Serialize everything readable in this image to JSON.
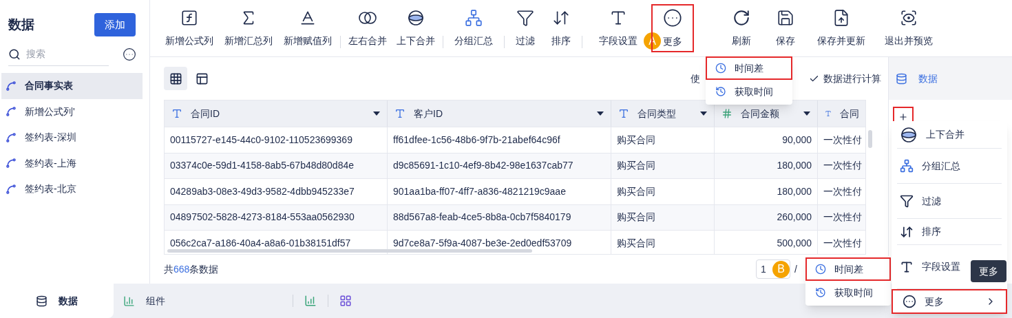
{
  "sidebar": {
    "title": "数据",
    "add_button": "添加",
    "search": {
      "placeholder": "搜索"
    },
    "items": [
      {
        "label": "合同事实表",
        "selected": true
      },
      {
        "label": "新增公式列'",
        "selected": false
      },
      {
        "label": "签约表-深圳",
        "selected": false
      },
      {
        "label": "签约表-上海",
        "selected": false
      },
      {
        "label": "签约表-北京",
        "selected": false
      }
    ]
  },
  "toolbar": {
    "groups": [
      [
        {
          "label": "新增公式列"
        },
        {
          "label": "新增汇总列"
        },
        {
          "label": "新增赋值列"
        }
      ],
      [
        {
          "label": "左右合并"
        },
        {
          "label": "上下合并"
        }
      ],
      [
        {
          "label": "分组汇总"
        }
      ],
      [
        {
          "label": "过滤"
        },
        {
          "label": "排序"
        }
      ],
      [
        {
          "label": "字段设置",
          "badge": "A"
        },
        {
          "label": "更多",
          "highlighted": true
        }
      ]
    ],
    "actions": [
      {
        "label": "刷新"
      },
      {
        "label": "保存"
      },
      {
        "label": "保存并更新"
      },
      {
        "label": "退出并预览"
      }
    ]
  },
  "view_toggle": [
    {
      "selected": true
    },
    {
      "selected": false
    }
  ],
  "calc_option": {
    "prefix": "使",
    "label": "数据进行计算"
  },
  "table": {
    "columns": [
      {
        "label": "合同ID",
        "kind": "text"
      },
      {
        "label": "客户ID",
        "kind": "text"
      },
      {
        "label": "合同类型",
        "kind": "text"
      },
      {
        "label": "合同金额",
        "kind": "number"
      },
      {
        "label": "合同",
        "kind": "text"
      }
    ],
    "rows": [
      [
        "00115727-e145-44c0-9102-110523699369",
        "ff61dfee-1c56-48b6-9f7b-21abef64c96f",
        "购买合同",
        "90,000",
        "一次性付"
      ],
      [
        "03374c0e-59d1-4158-8ab5-67b48d80d84e",
        "d9c85691-1c10-4ef9-8b42-98e1637cab77",
        "购买合同",
        "180,000",
        "一次性付"
      ],
      [
        "04289ab3-08e3-49d3-9582-4dbb945233e7",
        "901aa1ba-ff07-4ff7-a836-4821219c9aae",
        "购买合同",
        "180,000",
        "一次性付"
      ],
      [
        "04897502-5828-4273-8184-553aa0562930",
        "88d567a8-feab-4ce5-8b8a-0cb7f5840179",
        "购买合同",
        "260,000",
        "一次性付"
      ],
      [
        "056c2ca7-a186-40a4-a8a6-01b38151df57",
        "9d7ce8a7-5f9a-4087-be3e-2ed0edf53709",
        "购买合同",
        "500,000",
        "一次性付"
      ]
    ]
  },
  "footer": {
    "prefix": "共",
    "count": "668",
    "suffix": "条数据",
    "page": "1",
    "separator": "/",
    "badge": "B"
  },
  "popup_a": [
    {
      "label": "时间差",
      "highlighted": true
    },
    {
      "label": "获取时间",
      "highlighted": false
    }
  ],
  "popup_b": [
    {
      "label": "时间差",
      "highlighted": true
    },
    {
      "label": "获取时间",
      "highlighted": false
    }
  ],
  "right_panel": {
    "data_item": "数据",
    "add_highlighted": true,
    "menu": [
      {
        "label": "上下合并",
        "highlighted": false
      },
      {
        "label": "分组汇总",
        "highlighted": false
      },
      {
        "label": "过滤",
        "highlighted": false
      },
      {
        "label": "排序",
        "highlighted": false
      },
      {
        "label": "字段设置",
        "highlighted": false
      },
      {
        "label": "更多",
        "highlighted": true
      }
    ],
    "tooltip": "更多"
  },
  "bottom_tabs": [
    {
      "label": "数据",
      "selected": true
    },
    {
      "label": "组件",
      "selected": false
    }
  ]
}
